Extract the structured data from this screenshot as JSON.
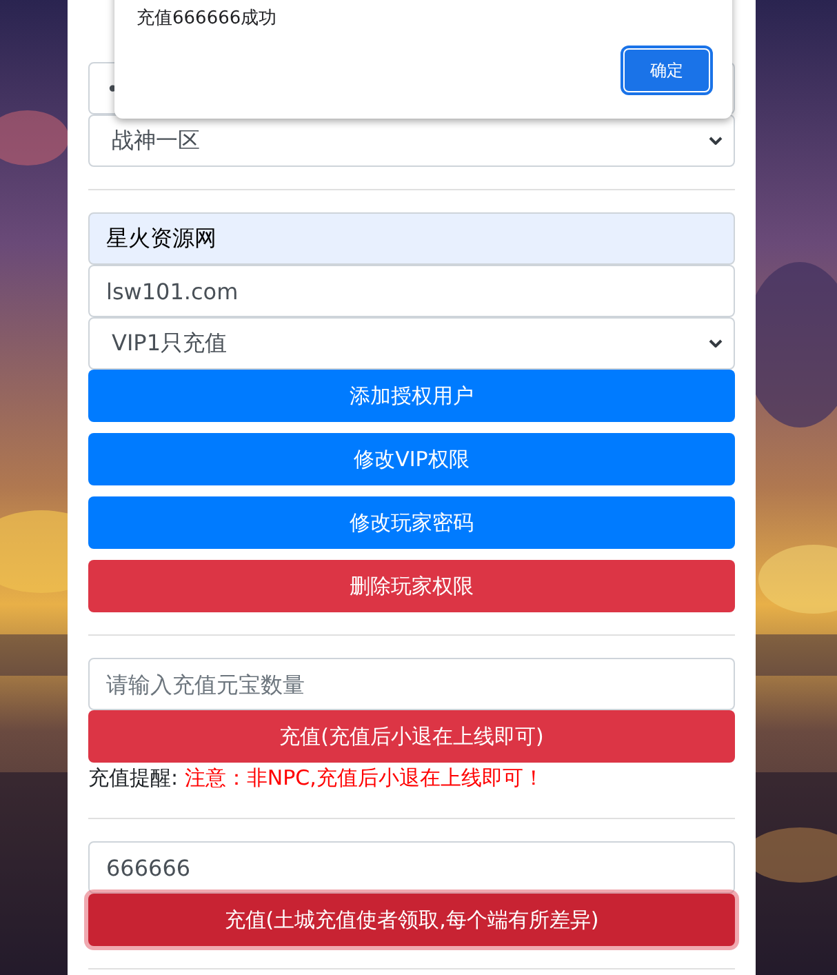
{
  "form": [
    {
      "kind": "field",
      "value": "•"
    },
    {
      "kind": "select",
      "value": "战神一区"
    },
    {
      "kind": "divider"
    },
    {
      "kind": "field",
      "value": "星火资源网",
      "autofilled": true
    },
    {
      "kind": "field",
      "value": "lsw101.com"
    },
    {
      "kind": "select",
      "value": "VIP1只充值"
    },
    {
      "kind": "button",
      "label": "添加授权用户",
      "color": "#007bff",
      "focused": false
    },
    {
      "kind": "button",
      "label": "修改VIP权限",
      "color": "#007bff",
      "focused": false
    },
    {
      "kind": "button",
      "label": "修改玩家密码",
      "color": "#007bff",
      "focused": false
    },
    {
      "kind": "button",
      "label": "删除玩家权限",
      "color": "#dc3545",
      "focused": false
    },
    {
      "kind": "divider"
    },
    {
      "kind": "field",
      "placeholder": "请输入充值元宝数量"
    },
    {
      "kind": "button",
      "label": "充值(充值后小退在上线即可)",
      "color": "#dc3545",
      "focused": false
    },
    {
      "kind": "note",
      "label": "充值提醒:",
      "text": "注意：非NPC,充值后小退在上线即可！"
    },
    {
      "kind": "divider"
    },
    {
      "kind": "field",
      "value": "666666"
    },
    {
      "kind": "button",
      "label": "充值(土城充值使者领取,每个端有所差异)",
      "color": "#c82333",
      "focused": true
    },
    {
      "kind": "divider"
    }
  ],
  "dialog": {
    "message": "充值666666成功",
    "button": "确定"
  }
}
